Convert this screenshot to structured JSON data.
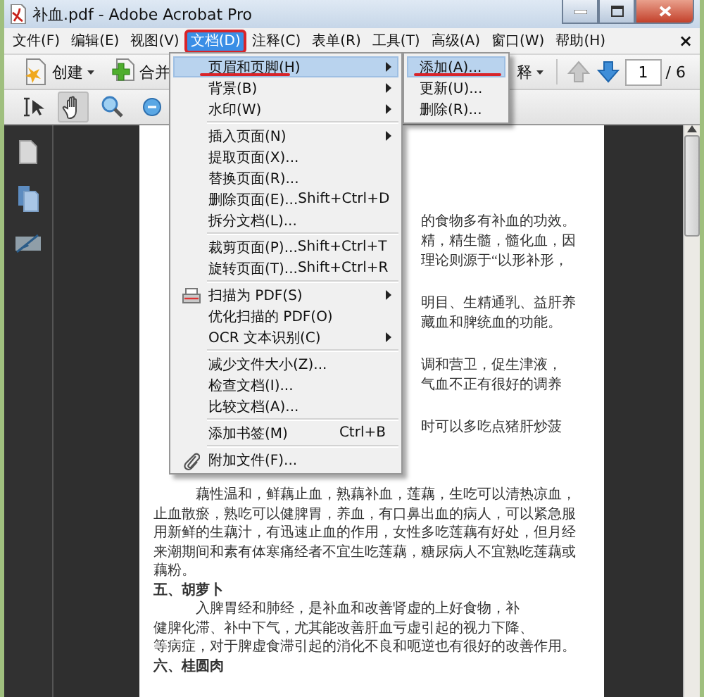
{
  "window": {
    "title": "补血.pdf - Adobe Acrobat Pro"
  },
  "menu_bar": {
    "items": [
      {
        "label": "文件(F)",
        "selected": false,
        "annotated": false
      },
      {
        "label": "编辑(E)",
        "selected": false,
        "annotated": false
      },
      {
        "label": "视图(V)",
        "selected": false,
        "annotated": false
      },
      {
        "label": "文档(D)",
        "selected": true,
        "annotated": true
      },
      {
        "label": "注释(C)",
        "selected": false,
        "annotated": false
      },
      {
        "label": "表单(R)",
        "selected": false,
        "annotated": false
      },
      {
        "label": "工具(T)",
        "selected": false,
        "annotated": false
      },
      {
        "label": "高级(A)",
        "selected": false,
        "annotated": false
      },
      {
        "label": "窗口(W)",
        "selected": false,
        "annotated": false
      },
      {
        "label": "帮助(H)",
        "selected": false,
        "annotated": false
      }
    ],
    "close": "×"
  },
  "toolbar": {
    "buttons": [
      {
        "label": "创建",
        "icon": true
      },
      {
        "label": "合并",
        "icon": true
      },
      {
        "label": "释",
        "icon": false
      }
    ],
    "page_number": "1",
    "page_count": "/ 6"
  },
  "tools": [
    {
      "selected": false
    },
    {
      "selected": true
    },
    {
      "selected": false
    },
    {
      "selected": false
    }
  ],
  "menu": {
    "groups": [
      [
        {
          "label": "页眉和页脚(H)",
          "submenu": true,
          "selected": true,
          "annotated": true
        },
        {
          "label": "背景(B)",
          "submenu": true,
          "selected": false,
          "annotated": false
        },
        {
          "label": "水印(W)",
          "submenu": true,
          "selected": false,
          "annotated": false
        }
      ],
      [
        {
          "label": "插入页面(N)",
          "submenu": true,
          "selected": false,
          "annotated": false
        },
        {
          "label": "提取页面(X)...",
          "submenu": false,
          "selected": false,
          "annotated": false
        },
        {
          "label": "替换页面(R)...",
          "submenu": false,
          "selected": false,
          "annotated": false
        },
        {
          "label": "删除页面(E)...",
          "shortcut": "Shift+Ctrl+D",
          "submenu": false,
          "selected": false,
          "annotated": false
        },
        {
          "label": "拆分文档(L)...",
          "submenu": false,
          "selected": false,
          "annotated": false
        }
      ],
      [
        {
          "label": "裁剪页面(P)...",
          "shortcut": "Shift+Ctrl+T",
          "submenu": false,
          "selected": false,
          "annotated": false
        },
        {
          "label": "旋转页面(T)...",
          "shortcut": "Shift+Ctrl+R",
          "submenu": false,
          "selected": false,
          "annotated": false
        }
      ],
      [
        {
          "label": "扫描为 PDF(S)",
          "submenu": true,
          "icon": true,
          "selected": false,
          "annotated": false
        },
        {
          "label": "优化扫描的 PDF(O)",
          "submenu": false,
          "selected": false,
          "annotated": false
        },
        {
          "label": "OCR 文本识别(C)",
          "submenu": true,
          "selected": false,
          "annotated": false
        }
      ],
      [
        {
          "label": "减少文件大小(Z)...",
          "submenu": false,
          "selected": false,
          "annotated": false
        },
        {
          "label": "检查文档(I)...",
          "submenu": false,
          "selected": false,
          "annotated": false
        },
        {
          "label": "比较文档(A)...",
          "submenu": false,
          "selected": false,
          "annotated": false
        }
      ],
      [
        {
          "label": "添加书签(M)",
          "shortcut": "Ctrl+B",
          "submenu": false,
          "selected": false,
          "annotated": false
        }
      ],
      [
        {
          "label": "附加文件(F)...",
          "submenu": false,
          "icon": true,
          "selected": false,
          "annotated": false
        }
      ]
    ]
  },
  "submenu": {
    "items": [
      {
        "label": "添加(A)...",
        "selected": true,
        "annotated": true
      },
      {
        "label": "更新(U)...",
        "selected": false,
        "annotated": false
      },
      {
        "label": "删除(R)...",
        "selected": false,
        "annotated": false
      }
    ]
  },
  "document": {
    "covered_paragraphs": [
      [
        "的食物多有补血的功效。",
        "精，精生髓，髓化血，因",
        "理论则源于“以形补形，"
      ],
      [
        "明目、生精通乳、益肝养",
        "藏血和脾统血的功能。"
      ],
      [
        "调和营卫，促生津液，",
        "气血不正有很好的调养"
      ],
      [
        "时可以多吃点猪肝炒菠"
      ]
    ],
    "paragraphs": [
      {
        "kind": "text",
        "lines": [
          "藕性温和，鲜藕止血，熟藕补血，莲藕，生吃可以清热凉血，",
          "止血散瘀，熟吃可以健脾胃，养血，有口鼻出血的病人，可以紧急服",
          "用新鲜的生藕汁，有迅速止血的作用，女性多吃莲藕有好处，但月经",
          "来潮期间和素有体寒痛经者不宜生吃莲藕，糖尿病人不宜熟吃莲藕或",
          "藕粉。"
        ]
      },
      {
        "kind": "heading",
        "lines": [
          "五、胡萝卜"
        ]
      },
      {
        "kind": "text",
        "lines": [
          "入脾胃经和肺经，是补血和改善肾虚的上好食物，补",
          "健脾化滞、补中下气，尤其能改善肝血亏虚引起的视力下降、",
          "等病症，对于脾虚食滞引起的消化不良和呃逆也有很好的改善作用。"
        ]
      },
      {
        "kind": "heading",
        "lines": [
          "六、桂圆肉"
        ]
      }
    ]
  }
}
